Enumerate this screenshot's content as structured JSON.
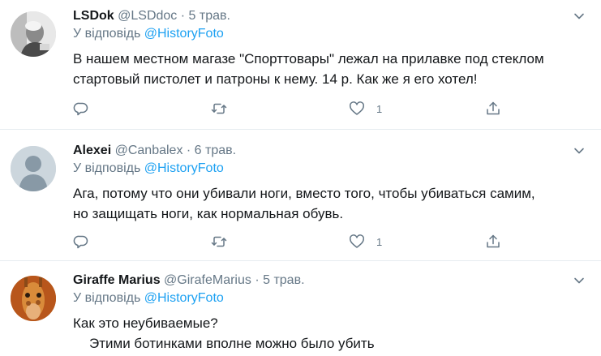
{
  "tweets": [
    {
      "name": "LSDok",
      "handle": "@LSDdoc",
      "separator": "·",
      "time": "5 трав.",
      "reply_prefix": "У відповідь",
      "reply_to": "@HistoryFoto",
      "lines": [
        "В нашем местном магазе \"Спорттовары\" лежал на прилавке под стеклом",
        "стартовый пистолет и патроны к нему. 14 р. Как же я его хотел!"
      ],
      "like_count": "1"
    },
    {
      "name": "Alexei",
      "handle": "@Canbalex",
      "separator": "·",
      "time": "6 трав.",
      "reply_prefix": "У відповідь",
      "reply_to": "@HistoryFoto",
      "lines": [
        "Ага, потому что они убивали ноги, вместо того, чтобы убиваться самим,",
        "но защищать ноги, как нормальная обувь."
      ],
      "like_count": "1"
    },
    {
      "name": "Giraffe Marius",
      "handle": "@GirafeMarius",
      "separator": "·",
      "time": "5 трав.",
      "reply_prefix": "У відповідь",
      "reply_to": "@HistoryFoto",
      "lines": [
        "Как это неубиваемые?",
        "Этими ботинками вполне можно было убить"
      ]
    }
  ],
  "icons": {
    "reply": "reply-icon",
    "retweet": "retweet-icon",
    "like": "heart-icon",
    "share": "share-icon",
    "more": "chevron-down-icon"
  },
  "colors": {
    "link": "#1da1f2",
    "secondary_text": "#657786",
    "divider": "#e6ecf0"
  }
}
